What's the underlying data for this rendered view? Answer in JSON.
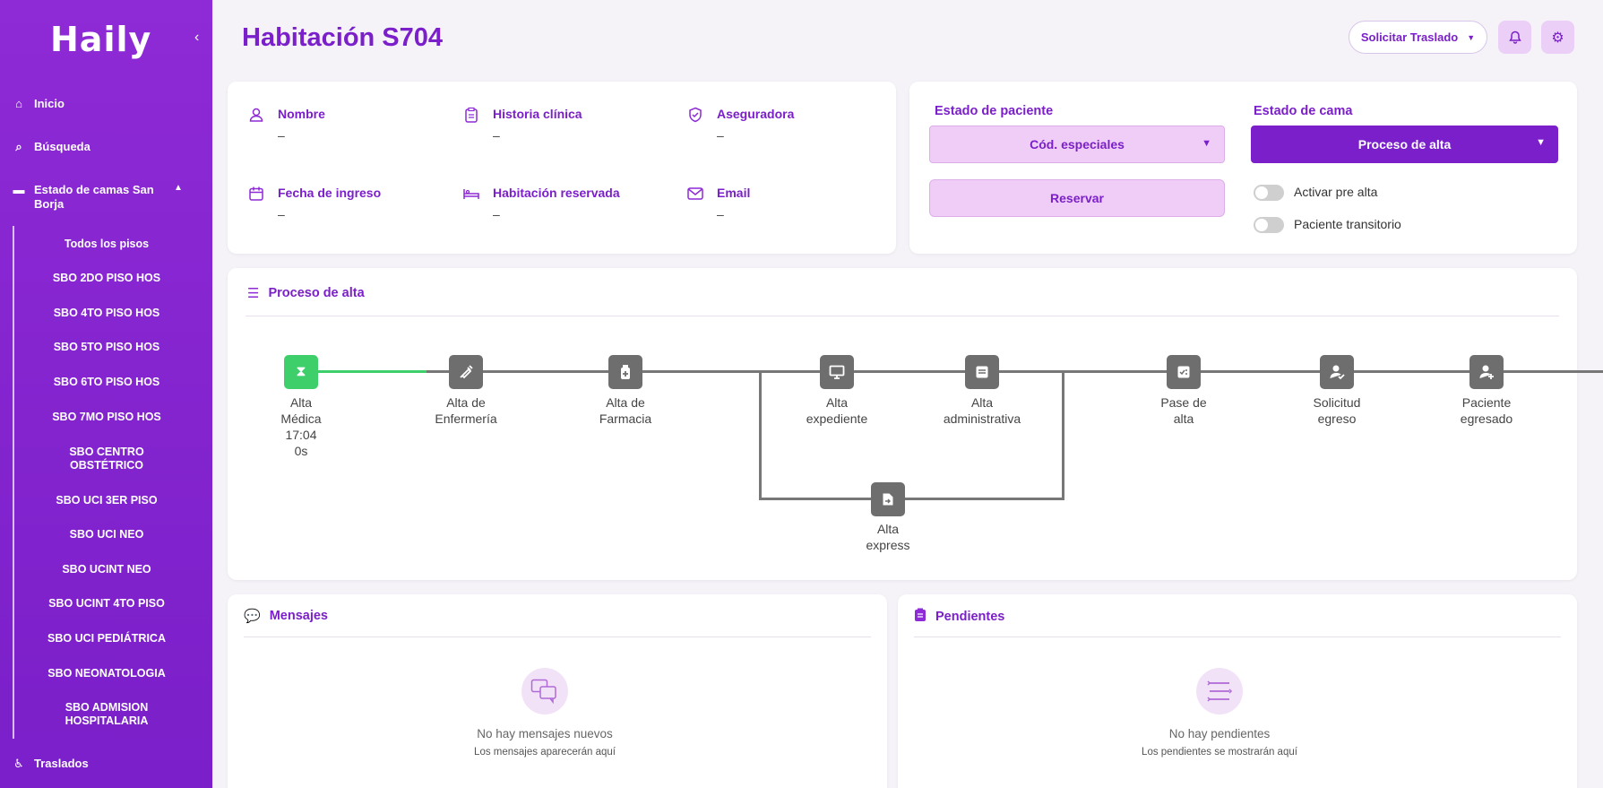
{
  "app": {
    "logo": "Haily",
    "collapse_icon": "chevron-left-icon"
  },
  "sidebar": {
    "inicio": "Inicio",
    "busqueda": "Búsqueda",
    "estado_camas": "Estado de camas San Borja",
    "traslados": "Traslados",
    "floors": [
      "Todos los pisos",
      "SBO 2DO PISO HOS",
      "SBO 4TO PISO HOS",
      "SBO 5TO PISO HOS",
      "SBO 6TO PISO HOS",
      "SBO 7MO PISO HOS",
      "SBO CENTRO OBSTÉTRICO",
      "SBO UCI 3ER PISO",
      "SBO UCI NEO",
      "SBO UCINT NEO",
      "SBO UCINT 4TO PISO",
      "SBO UCI PEDIÁTRICA",
      "SBO NEONATOLOGIA",
      "SBO ADMISION HOSPITALARIA"
    ]
  },
  "header": {
    "title": "Habitación S704",
    "traslado_button": "Solicitar Traslado"
  },
  "patient": {
    "nombre": {
      "label": "Nombre",
      "value": "–"
    },
    "historia": {
      "label": "Historia clínica",
      "value": "–"
    },
    "aseguradora": {
      "label": "Aseguradora",
      "value": "–"
    },
    "fecha_ingreso": {
      "label": "Fecha de ingreso",
      "value": "–"
    },
    "habitacion_reservada": {
      "label": "Habitación reservada",
      "value": "–"
    },
    "email": {
      "label": "Email",
      "value": "–"
    }
  },
  "estado": {
    "paciente_label": "Estado de paciente",
    "paciente_value": "Cód. especiales",
    "cama_label": "Estado de cama",
    "cama_value": "Proceso de alta",
    "reservar": "Reservar",
    "pre_alta": "Activar pre alta",
    "transitorio": "Paciente transitorio"
  },
  "proceso": {
    "title": "Proceso de alta",
    "steps": [
      {
        "line1": "Alta",
        "line2": "Médica",
        "line3": "17:04",
        "line4": "0s",
        "icon": "hourglass-icon",
        "status": "active"
      },
      {
        "line1": "Alta de",
        "line2": "Enfermería",
        "icon": "syringe-icon"
      },
      {
        "line1": "Alta de",
        "line2": "Farmacia",
        "icon": "medicine-icon"
      },
      {
        "line1": "Alta",
        "line2": "expediente",
        "icon": "monitor-icon"
      },
      {
        "line1": "Alta",
        "line2": "administrativa",
        "icon": "document-icon"
      },
      {
        "line1": "Pase de",
        "line2": "alta",
        "icon": "checklist-icon"
      },
      {
        "line1": "Solicitud",
        "line2": "egreso",
        "icon": "user-check-icon"
      },
      {
        "line1": "Paciente",
        "line2": "egresado",
        "icon": "user-plus-icon"
      },
      {
        "line1": "Alta",
        "line2": "express",
        "icon": "file-arrow-icon"
      }
    ]
  },
  "mensajes": {
    "title": "Mensajes",
    "empty_title": "No hay mensajes nuevos",
    "empty_sub": "Los mensajes aparecerán aquí"
  },
  "pendientes": {
    "title": "Pendientes",
    "empty_title": "No hay pendientes",
    "empty_sub": "Los pendientes se mostrarán aquí"
  }
}
